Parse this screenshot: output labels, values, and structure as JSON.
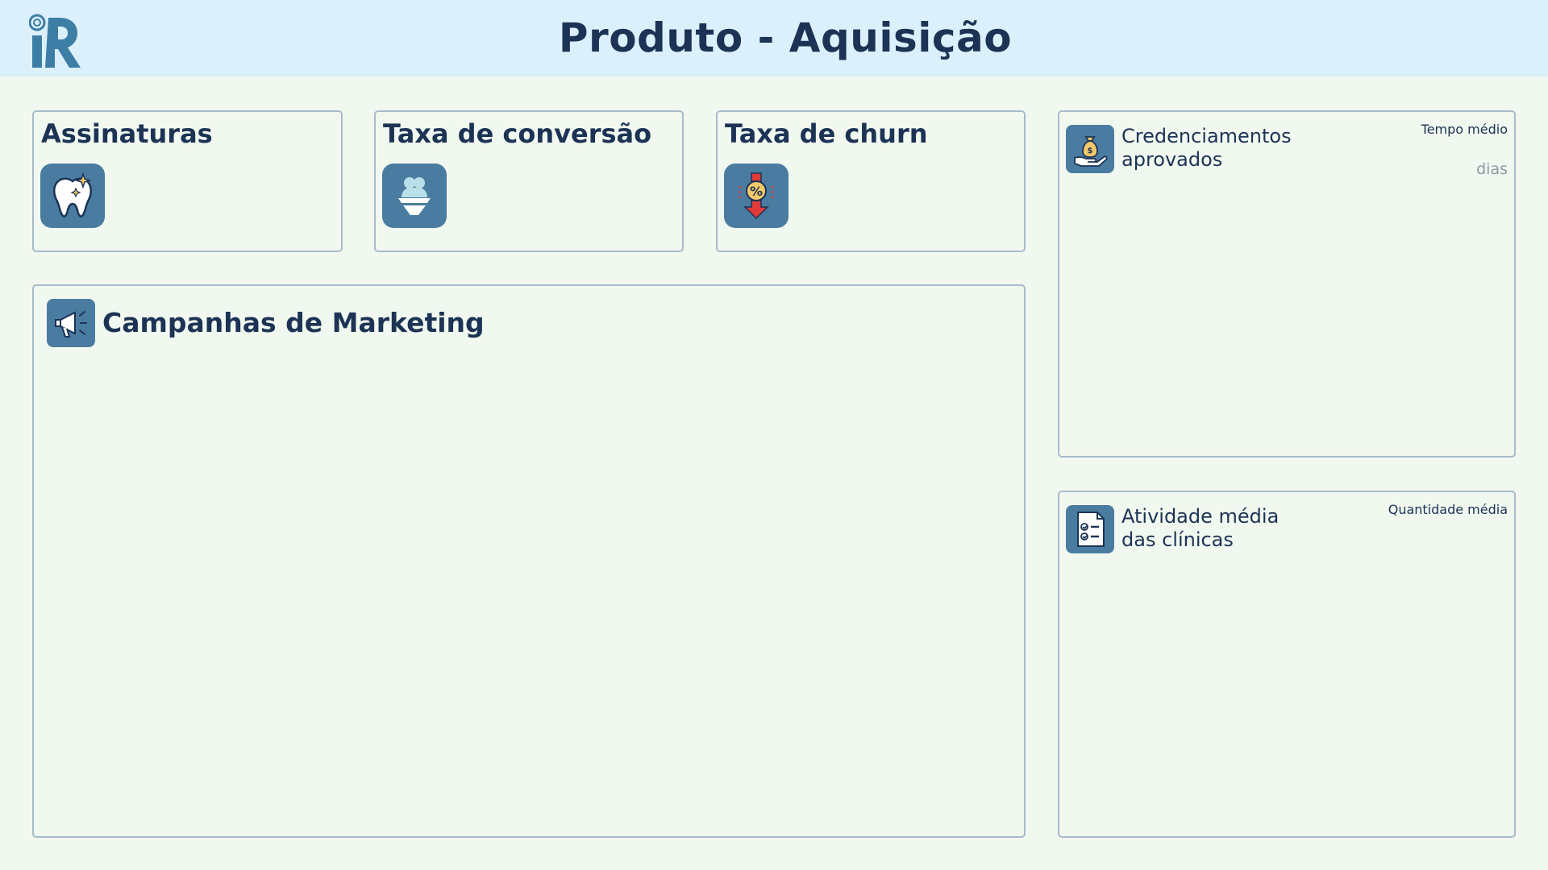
{
  "header": {
    "title": "Produto - Aquisição",
    "logo_icon": "tooth-r-logo-icon"
  },
  "kpis": [
    {
      "label": "Assinaturas",
      "icon": "tooth-sparkle-icon"
    },
    {
      "label": "Taxa de conversão",
      "icon": "funnel-users-icon"
    },
    {
      "label": "Taxa de churn",
      "icon": "percent-down-arrow-icon"
    }
  ],
  "marketing": {
    "title": "Campanhas de Marketing",
    "icon": "megaphone-icon"
  },
  "credenciamentos": {
    "title_line1": "Credenciamentos",
    "title_line2": "aprovados",
    "meta": "Tempo médio",
    "unit": "dias",
    "icon": "money-bag-hand-icon"
  },
  "atividade": {
    "title_line1": "Atividade média",
    "title_line2": "das clínicas",
    "meta": "Quantidade média",
    "icon": "checklist-document-icon"
  },
  "colors": {
    "header_bg": "#dcf0fb",
    "page_bg": "#f1f8ef",
    "icon_bg": "#4a7ca1",
    "text": "#1c3355",
    "border": "#a6bccb"
  }
}
